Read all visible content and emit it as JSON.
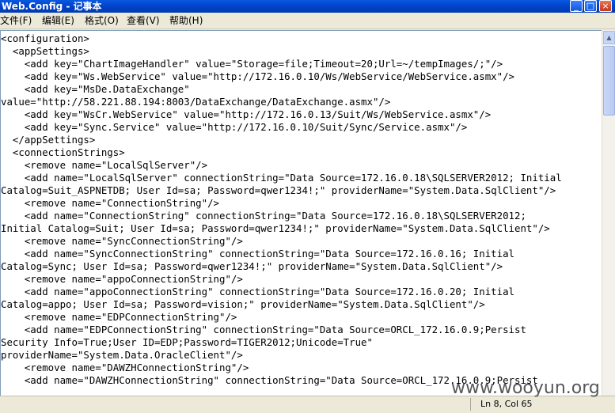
{
  "window": {
    "title": "Web.Config - 记事本",
    "minimize": "_",
    "maximize": "□",
    "close": "×"
  },
  "menu": [
    {
      "label": "文件(F)"
    },
    {
      "label": "编辑(E)"
    },
    {
      "label": "格式(O)"
    },
    {
      "label": "查看(V)"
    },
    {
      "label": "帮助(H)"
    }
  ],
  "editor_lines": [
    "<configuration>",
    "  <appSettings>",
    "    <add key=\"ChartImageHandler\" value=\"Storage=file;Timeout=20;Url=~/tempImages/;\"/>",
    "    <add key=\"Ws.WebService\" value=\"http://172.16.0.10/Ws/WebService/WebService.asmx\"/>",
    "    <add key=\"MsDe.DataExchange\"",
    "value=\"http://58.221.88.194:8003/DataExchange/DataExchange.asmx\"/>",
    "    <add key=\"WsCr.WebService\" value=\"http://172.16.0.13/Suit/Ws/WebService.asmx\"/>",
    "    <add key=\"Sync.Service\" value=\"http://172.16.0.10/Suit/Sync/Service.asmx\"/>",
    "  </appSettings>",
    "  <connectionStrings>",
    "    <remove name=\"LocalSqlServer\"/>",
    "    <add name=\"LocalSqlServer\" connectionString=\"Data Source=172.16.0.18\\SQLSERVER2012; Initial",
    "Catalog=Suit_ASPNETDB; User Id=sa; Password=qwer1234!;\" providerName=\"System.Data.SqlClient\"/>",
    "    <remove name=\"ConnectionString\"/>",
    "    <add name=\"ConnectionString\" connectionString=\"Data Source=172.16.0.18\\SQLSERVER2012;",
    "Initial Catalog=Suit; User Id=sa; Password=qwer1234!;\" providerName=\"System.Data.SqlClient\"/>",
    "    <remove name=\"SyncConnectionString\"/>",
    "    <add name=\"SyncConnectionString\" connectionString=\"Data Source=172.16.0.16; Initial",
    "Catalog=Sync; User Id=sa; Password=qwer1234!;\" providerName=\"System.Data.SqlClient\"/>",
    "    <remove name=\"appoConnectionString\"/>",
    "    <add name=\"appoConnectionString\" connectionString=\"Data Source=172.16.0.20; Initial",
    "Catalog=appo; User Id=sa; Password=vision;\" providerName=\"System.Data.SqlClient\"/>",
    "    <remove name=\"EDPConnectionString\"/>",
    "    <add name=\"EDPConnectionString\" connectionString=\"Data Source=ORCL_172.16.0.9;Persist",
    "Security Info=True;User ID=EDP;Password=TIGER2012;Unicode=True\"",
    "providerName=\"System.Data.OracleClient\"/>",
    "    <remove name=\"DAWZHConnectionString\"/>",
    "    <add name=\"DAWZHConnectionString\" connectionString=\"Data Source=ORCL_172.16.0.9;Persist"
  ],
  "status": {
    "position": "Ln 8, Col 65"
  },
  "watermark": "www.wooyun.org"
}
